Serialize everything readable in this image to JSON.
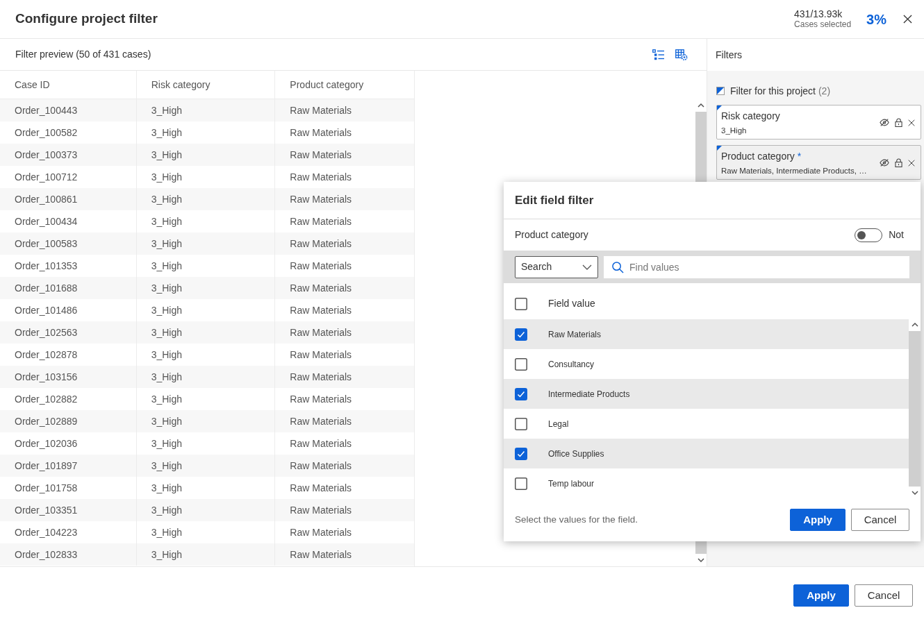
{
  "dialog": {
    "title": "Configure project filter",
    "case_count": "431/13.93k",
    "case_count_label": "Cases selected",
    "percent": "3%"
  },
  "preview": {
    "title": "Filter preview (50 of 431 cases)",
    "columns": [
      "Case ID",
      "Risk category",
      "Product category"
    ],
    "rows": [
      [
        "Order_100443",
        "3_High",
        "Raw Materials"
      ],
      [
        "Order_100582",
        "3_High",
        "Raw Materials"
      ],
      [
        "Order_100373",
        "3_High",
        "Raw Materials"
      ],
      [
        "Order_100712",
        "3_High",
        "Raw Materials"
      ],
      [
        "Order_100861",
        "3_High",
        "Raw Materials"
      ],
      [
        "Order_100434",
        "3_High",
        "Raw Materials"
      ],
      [
        "Order_100583",
        "3_High",
        "Raw Materials"
      ],
      [
        "Order_101353",
        "3_High",
        "Raw Materials"
      ],
      [
        "Order_101688",
        "3_High",
        "Raw Materials"
      ],
      [
        "Order_101486",
        "3_High",
        "Raw Materials"
      ],
      [
        "Order_102563",
        "3_High",
        "Raw Materials"
      ],
      [
        "Order_102878",
        "3_High",
        "Raw Materials"
      ],
      [
        "Order_103156",
        "3_High",
        "Raw Materials"
      ],
      [
        "Order_102882",
        "3_High",
        "Raw Materials"
      ],
      [
        "Order_102889",
        "3_High",
        "Raw Materials"
      ],
      [
        "Order_102036",
        "3_High",
        "Raw Materials"
      ],
      [
        "Order_101897",
        "3_High",
        "Raw Materials"
      ],
      [
        "Order_101758",
        "3_High",
        "Raw Materials"
      ],
      [
        "Order_103351",
        "3_High",
        "Raw Materials"
      ],
      [
        "Order_104223",
        "3_High",
        "Raw Materials"
      ],
      [
        "Order_102833",
        "3_High",
        "Raw Materials"
      ]
    ]
  },
  "filters_panel": {
    "title": "Filters",
    "group": {
      "label": "Filter for this project",
      "count": "(2)",
      "indeterminate": true
    },
    "filters": [
      {
        "name": "Risk category",
        "value": "3_High",
        "enabled": true,
        "selected": false
      },
      {
        "name": "Product category",
        "marker": "*",
        "value": "Raw Materials, Intermediate Products, …",
        "enabled": true,
        "selected": true
      }
    ]
  },
  "edit_filter": {
    "title": "Edit field filter",
    "field": "Product category",
    "not_toggle": {
      "label": "Not",
      "on": false
    },
    "mode_select": {
      "value": "Search"
    },
    "search": {
      "placeholder": "Find values"
    },
    "header": {
      "label": "Field value",
      "checked": false
    },
    "values": [
      {
        "label": "Raw Materials",
        "checked": true
      },
      {
        "label": "Consultancy",
        "checked": false
      },
      {
        "label": "Intermediate Products",
        "checked": true
      },
      {
        "label": "Legal",
        "checked": false
      },
      {
        "label": "Office Supplies",
        "checked": true
      },
      {
        "label": "Temp labour",
        "checked": false
      }
    ],
    "hint": "Select the values for the field.",
    "buttons": [
      {
        "label": "Apply",
        "kind": "primary"
      },
      {
        "label": "Cancel",
        "kind": "secondary"
      }
    ]
  },
  "footer": {
    "buttons": [
      {
        "label": "Apply",
        "kind": "primary"
      },
      {
        "label": "Cancel",
        "kind": "secondary"
      }
    ]
  }
}
